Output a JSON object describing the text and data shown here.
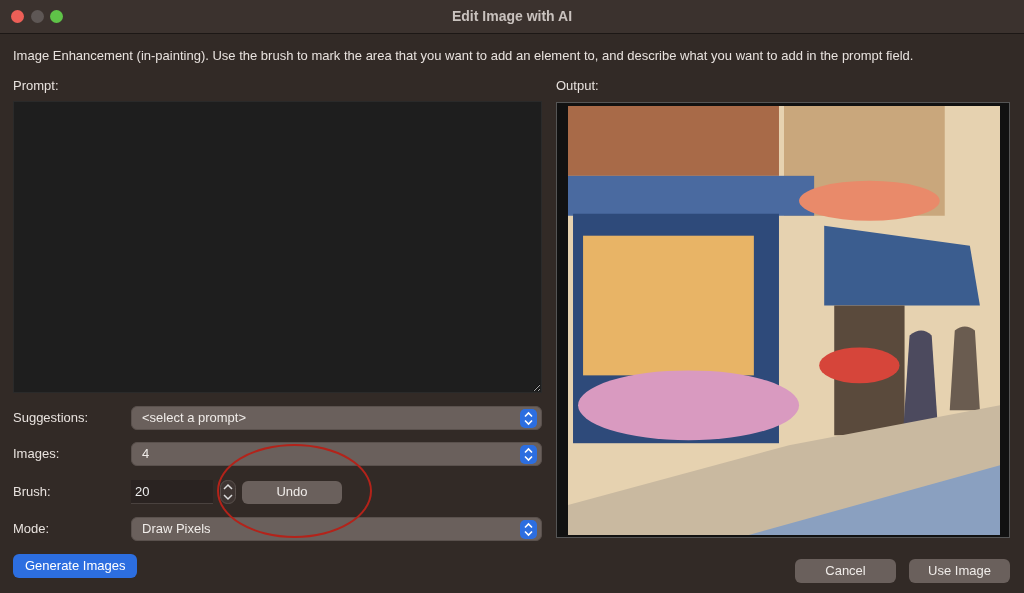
{
  "window": {
    "title": "Edit Image with AI"
  },
  "description": "Image Enhancement (in-painting). Use the brush to mark the area that you want to add an element to, and describe what you want to add in the prompt field.",
  "prompt_label": "Prompt:",
  "fields": [
    {
      "label": "Suggestions:",
      "kind": "dropdown",
      "value": "<select a prompt>"
    },
    {
      "label": "Images:",
      "kind": "dropdown",
      "value": "4"
    },
    {
      "label": "Brush:",
      "kind": "stepper",
      "value": "20",
      "button": "Undo"
    },
    {
      "label": "Mode:",
      "kind": "dropdown",
      "value": "Draw Pixels"
    }
  ],
  "output_label": "Output:",
  "buttons": [
    {
      "label": "Generate Images",
      "kind": "primary"
    },
    {
      "label": "Cancel",
      "kind": "secondary"
    },
    {
      "label": "Use Image",
      "kind": "secondary"
    }
  ]
}
